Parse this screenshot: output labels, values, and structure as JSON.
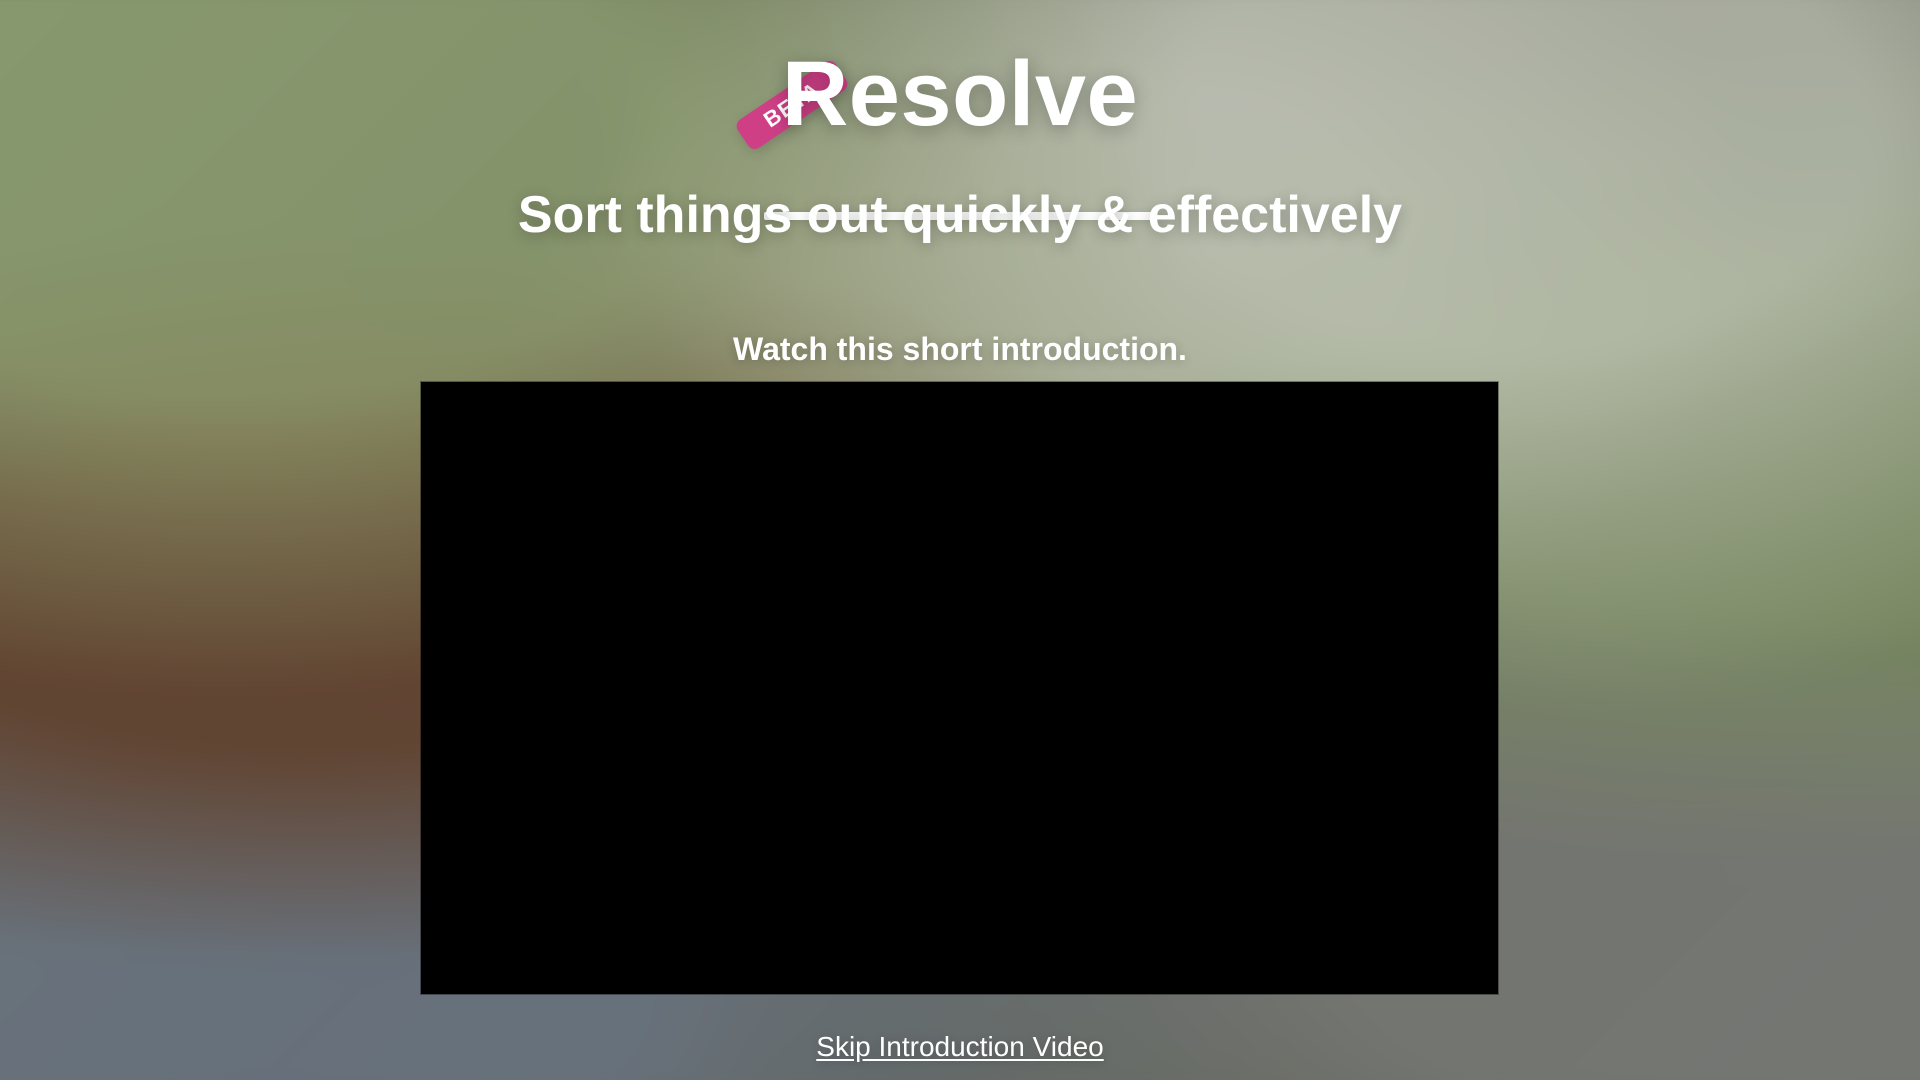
{
  "hero": {
    "title": "Resolve",
    "badge": "BETA",
    "subtitle": "Sort things out quickly & effectively"
  },
  "intro": {
    "label": "Watch this short introduction."
  },
  "actions": {
    "skip_label": "Skip Introduction Video"
  },
  "colors": {
    "badge_background": "#ce3f86",
    "text": "#ffffff",
    "video_background": "#000000"
  }
}
